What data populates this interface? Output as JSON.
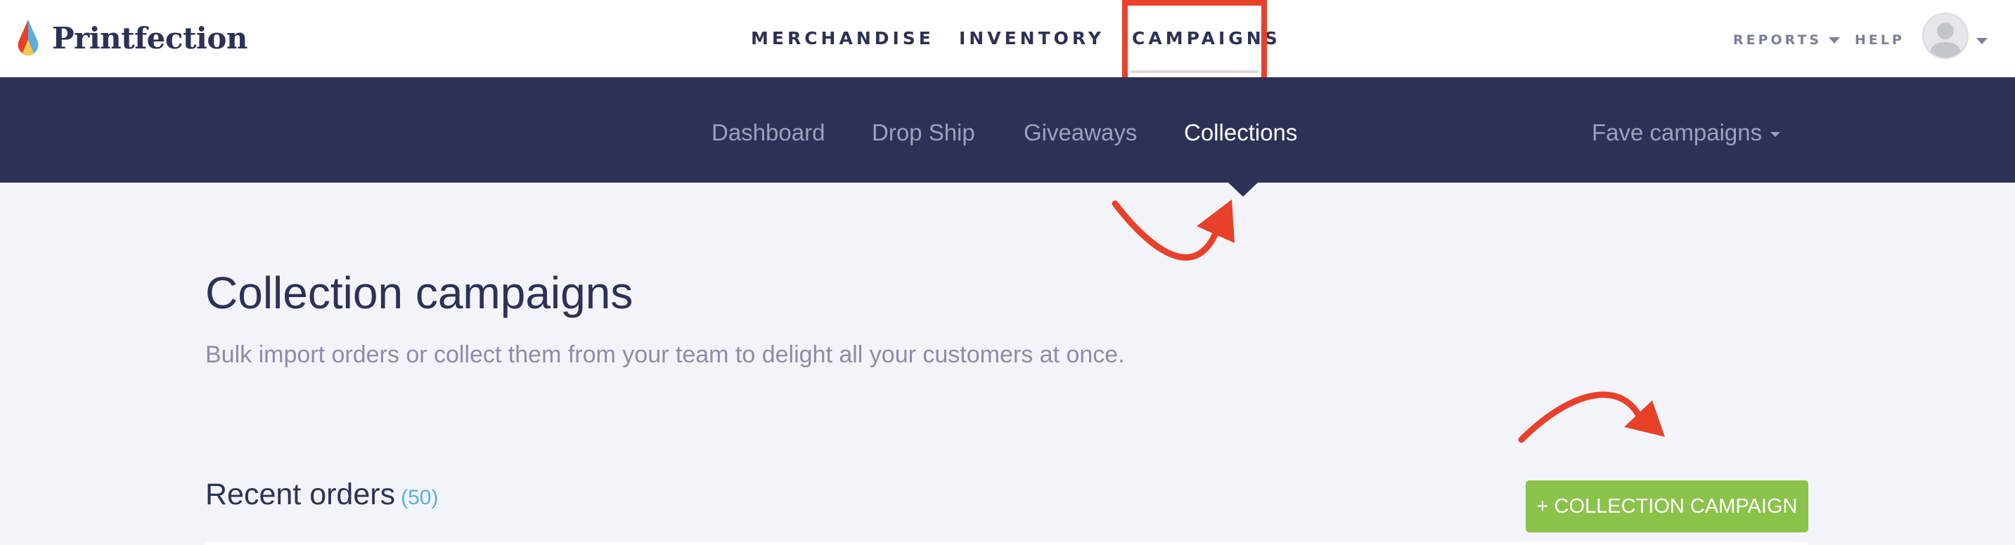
{
  "brand": {
    "name": "Printfection"
  },
  "main_nav": [
    {
      "label": "MERCHANDISE"
    },
    {
      "label": "INVENTORY"
    },
    {
      "label": "CAMPAIGNS",
      "active": true
    }
  ],
  "right_nav": {
    "reports": "REPORTS",
    "help": "HELP"
  },
  "sub_nav": [
    {
      "label": "Dashboard"
    },
    {
      "label": "Drop Ship"
    },
    {
      "label": "Giveaways"
    },
    {
      "label": "Collections",
      "active": true
    }
  ],
  "fave_campaigns": "Fave campaigns",
  "page": {
    "title": "Collection campaigns",
    "subtitle": "Bulk import orders or collect them from your team to delight all your customers at once."
  },
  "recent_orders": {
    "title": "Recent orders",
    "count": "(50)"
  },
  "actions": {
    "new_collection": "+ COLLECTION CAMPAIGN"
  },
  "colors": {
    "navy": "#2d3155",
    "accent_green": "#8bc34a",
    "annotation_red": "#e8412a",
    "count_blue": "#5aaee0"
  },
  "icons": [
    "logo-drop-icon",
    "caret-down-icon",
    "avatar-icon",
    "curved-arrow-icon"
  ]
}
